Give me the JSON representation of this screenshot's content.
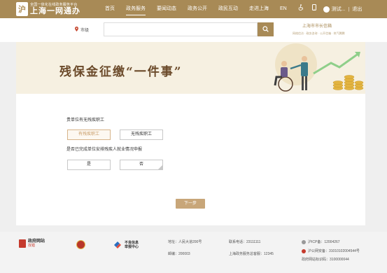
{
  "header": {
    "logo_badge": "沪",
    "logo_subtitle": "全国一体化在线政务服务平台",
    "logo_title": "上海一网通办",
    "nav": [
      "首页",
      "政务服务",
      "要闻动态",
      "政务公开",
      "政民互动",
      "走进上海",
      "EN"
    ],
    "active_nav": "政务服务",
    "accessibility_icon": "wheelchair-icon",
    "mobile_icon": "mobile-phone-icon",
    "user_label": "测试...",
    "separator": "|",
    "logout_label": "退出"
  },
  "search": {
    "location_icon": "map-pin-icon",
    "location_label": "市级",
    "query": "",
    "search_icon": "search-icon"
  },
  "city_mailbox": {
    "title": "上海市市长信箱",
    "links": "网络信访 · 政务咨询 · 公开信箱 · 热气腾腾"
  },
  "banner": {
    "title": "残保金征缴“一件事”"
  },
  "form": {
    "q1_label": "贵单位有无残疾职工",
    "q1_options": [
      "有残疾职工",
      "无残疾职工"
    ],
    "q1_selected": "有残疾职工",
    "q2_label": "是否已完成单位安排残疾人就业情况申报",
    "q2_options": [
      "是",
      "否"
    ],
    "next_label": "下一步"
  },
  "footer": {
    "logo1_title": "政府网站",
    "logo1_sub": "找错",
    "logo3_line1": "不良信息",
    "logo3_line2": "举报中心",
    "address": "地址：人民大道200号",
    "postcode": "邮编：200003",
    "phone": "联系电话：23111111",
    "hotline": "上海政务服务总客服：12345",
    "icp": "沪ICP备：12004267",
    "police": "沪公网安备：31010102004544号",
    "site_code": "政府网站标识码：3100000044"
  },
  "colors": {
    "brand": "#a88a56",
    "banner_bg": "#f6f0e1",
    "title": "#6b4a2a",
    "selected": "#c79a64",
    "next_button": "#c8a679"
  }
}
